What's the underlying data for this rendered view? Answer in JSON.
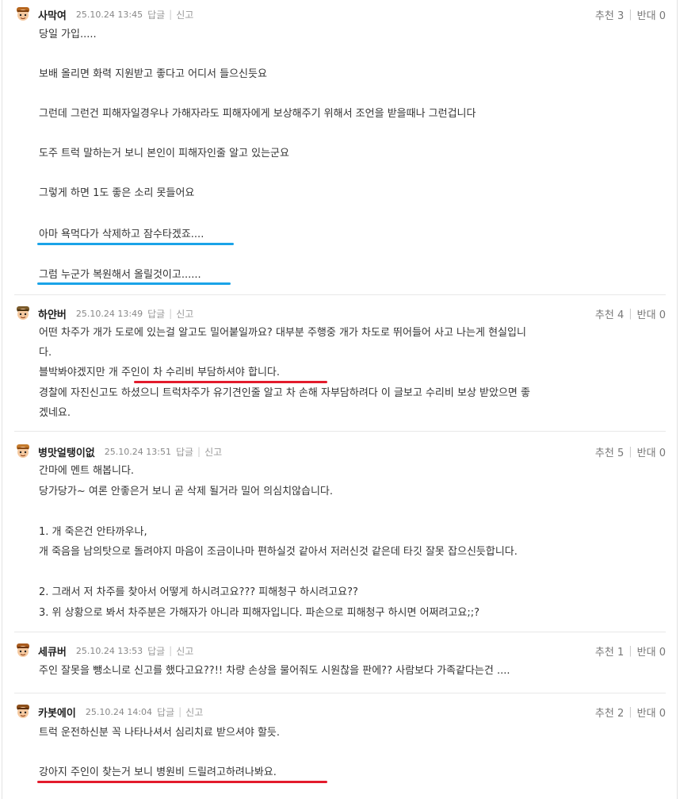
{
  "colors": {
    "highlight_blue": "#1aa3e8",
    "highlight_red": "#e31b2c"
  },
  "actions": {
    "reply": "답글",
    "report": "신고",
    "up": "추천",
    "down": "반대"
  },
  "comments": [
    {
      "nick": "사막여",
      "date": "25.10.24 13:45",
      "up": "3",
      "down": "0",
      "avatar_icon": "character-avatar-icon",
      "lines": [
        "당일 가입.....",
        "보배 올리면 화력 지원받고 좋다고 어디서 들으신듯요",
        "그런데 그런건 피해자일경우나 가해자라도 피해자에게 보상해주기 위해서 조언을 받을때나 그런겁니다",
        "도주 트럭 말하는거 보니 본인이 피해자인줄 알고 있는군요",
        "그렇게 하면 1도 좋은 소리 못들어요",
        "아마 욕먹다가 삭제하고 잠수타겠죠....",
        "그럼 누군가 복원해서 올릴것이고......"
      ]
    },
    {
      "nick": "하얀버",
      "date": "25.10.24 13:49",
      "up": "4",
      "down": "0",
      "avatar_icon": "character-avatar-icon",
      "lines": [
        "어떤 차주가 개가 도로에 있는걸 알고도 밀어붙일까요? 대부분 주행중 개가 차도로 뛰어들어 사고 나는게 현실입니",
        "다.",
        "블박봐야겠지만 개 주인이 차 수리비 부담하셔야 합니다.",
        "경찰에 자진신고도 하셨으니 트럭차주가 유기견인줄 알고 차 손해 자부담하려다 이 글보고 수리비 보상 받았으면 좋",
        "겠네요."
      ]
    },
    {
      "nick": "병맛얼탱이없",
      "date": "25.10.24 13:51",
      "up": "5",
      "down": "0",
      "avatar_icon": "character-avatar-icon",
      "lines": [
        "간마에 멘트 해봅니다.",
        "당가당가~ 여론 안좋은거 보니 곧 삭제 될거라 밀어 의심치않습니다.",
        "1. 개 죽은건 안타까우나,",
        "개 죽음을 남의탓으로 돌려야지 마음이 조금이나마 편하실것 같아서 저러신것 같은데 타깃 잘못 잡으신듯합니다.",
        "2. 그래서 저 차주를 찾아서 어떻게 하시려고요??? 피해청구 하시려고요??",
        "3. 위 상황으로 봐서 차주분은 가해자가 아니라 피해자입니다. 파손으로 피해청구 하시면 어쩌려고요;;?"
      ]
    },
    {
      "nick": "세큐버",
      "date": "25.10.24 13:53",
      "up": "1",
      "down": "0",
      "avatar_icon": "character-avatar-icon",
      "lines": [
        "주인 잘못을 뺑소니로 신고를 했다고요??!! 차량 손상을 물어줘도 시원찮을 판에?? 사람보다 가족같다는건 ...."
      ]
    },
    {
      "nick": "카봇에이",
      "date": "25.10.24 14:04",
      "up": "2",
      "down": "0",
      "avatar_icon": "character-avatar-icon",
      "lines": [
        "트럭 운전하신분 꼭 나타나셔서 심리치료 받으셔야 할듯.",
        "강아지 주인이 찾는거 보니 병원비 드릴려고하려나봐요."
      ]
    }
  ]
}
